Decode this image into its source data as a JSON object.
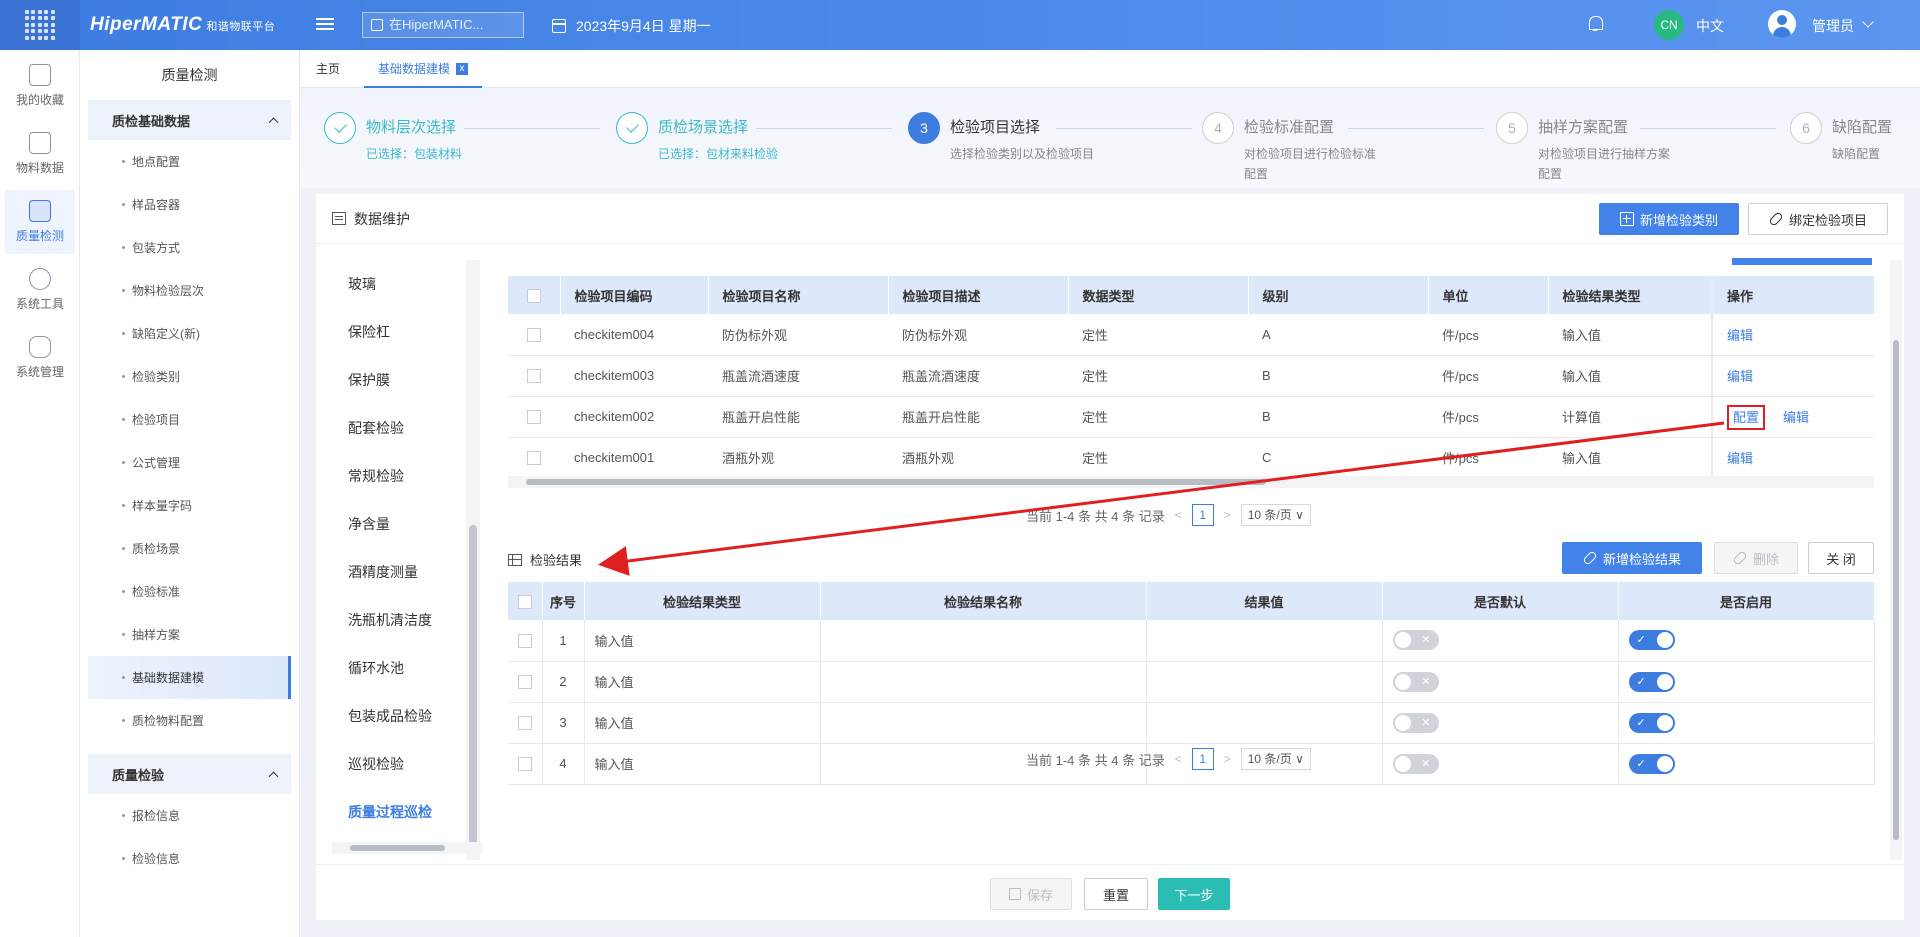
{
  "header": {
    "brand": "HiperMATIC",
    "brand_sub": "和谐物联平台",
    "search_placeholder": "在HiperMATIC...",
    "date": "2023年9月4日 星期一",
    "lang_badge": "CN",
    "lang": "中文",
    "user": "管理员"
  },
  "rail": [
    {
      "label": "我的收藏",
      "icon": "star-icon"
    },
    {
      "label": "物料数据",
      "icon": "cube-icon"
    },
    {
      "label": "质量检测",
      "icon": "shield-icon"
    },
    {
      "label": "系统工具",
      "icon": "nodes-icon"
    },
    {
      "label": "系统管理",
      "icon": "hexagon-icon"
    }
  ],
  "sidebar": {
    "title": "质量检测",
    "group1": "质检基础数据",
    "items1": [
      "地点配置",
      "样品容器",
      "包装方式",
      "物料检验层次",
      "缺陷定义(新)",
      "检验类别",
      "检验项目",
      "公式管理",
      "样本量字码",
      "质检场景",
      "检验标准",
      "抽样方案",
      "基础数据建模",
      "质检物料配置"
    ],
    "group2": "质量检验",
    "items2": [
      "报检信息",
      "检验信息"
    ]
  },
  "tabs": {
    "home": "主页",
    "current": "基础数据建模",
    "close": "x"
  },
  "steps": [
    {
      "num": "",
      "title": "物料层次选择",
      "desc": "已选择：包装材料"
    },
    {
      "num": "",
      "title": "质检场景选择",
      "desc": "已选择：包材来料检验"
    },
    {
      "num": "3",
      "title": "检验项目选择",
      "desc": "选择检验类别以及检验项目"
    },
    {
      "num": "4",
      "title": "检验标准配置",
      "desc": "对检验项目进行检验标准配置"
    },
    {
      "num": "5",
      "title": "抽样方案配置",
      "desc": "对检验项目进行抽样方案配置"
    },
    {
      "num": "6",
      "title": "缺陷配置",
      "desc": "缺陷配置"
    }
  ],
  "card": {
    "title": "数据维护",
    "btn_add_category": "新增检验类别",
    "btn_bind_item": "绑定检验项目"
  },
  "categories": [
    "玻璃",
    "保险杠",
    "保护膜",
    "配套检验",
    "常规检验",
    "净含量",
    "酒精度测量",
    "洗瓶机清洁度",
    "循环水池",
    "包装成品检验",
    "巡视检验",
    "质量过程巡检"
  ],
  "table1": {
    "headers": [
      "检验项目编码",
      "检验项目名称",
      "检验项目描述",
      "数据类型",
      "级别",
      "单位",
      "检验结果类型",
      "操作"
    ],
    "rows": [
      [
        "checkitem004",
        "防伪标外观",
        "防伪标外观",
        "定性",
        "A",
        "件/pcs",
        "输入值"
      ],
      [
        "checkitem003",
        "瓶盖流酒速度",
        "瓶盖流酒速度",
        "定性",
        "B",
        "件/pcs",
        "输入值"
      ],
      [
        "checkitem002",
        "瓶盖开启性能",
        "瓶盖开启性能",
        "定性",
        "B",
        "件/pcs",
        "计算值"
      ],
      [
        "checkitem001",
        "酒瓶外观",
        "酒瓶外观",
        "定性",
        "C",
        "件/pcs",
        "输入值"
      ]
    ],
    "op_edit": "编辑",
    "op_config": "配置"
  },
  "pager": {
    "summary": "当前 1-4 条 共 4 条 记录",
    "page": "1",
    "size": "10 条/页"
  },
  "results": {
    "title": "检验结果",
    "btn_add": "新增检验结果",
    "btn_delete": "删除",
    "btn_close": "关 闭",
    "headers": [
      "序号",
      "检验结果类型",
      "检验结果名称",
      "结果值",
      "是否默认",
      "是否启用"
    ],
    "rows": [
      {
        "no": "1",
        "type": "输入值",
        "name": "",
        "value": "",
        "default": false,
        "enabled": true
      },
      {
        "no": "2",
        "type": "输入值",
        "name": "",
        "value": "",
        "default": false,
        "enabled": true
      },
      {
        "no": "3",
        "type": "输入值",
        "name": "",
        "value": "",
        "default": false,
        "enabled": true
      },
      {
        "no": "4",
        "type": "输入值",
        "name": "",
        "value": "",
        "default": false,
        "enabled": true
      }
    ]
  },
  "footer": {
    "save": "保存",
    "reset": "重置",
    "next": "下一步"
  },
  "colors": {
    "primary": "#4382e8",
    "teal": "#2bbcb3",
    "success": "#3ab9c9",
    "annotation": "#e02020"
  }
}
